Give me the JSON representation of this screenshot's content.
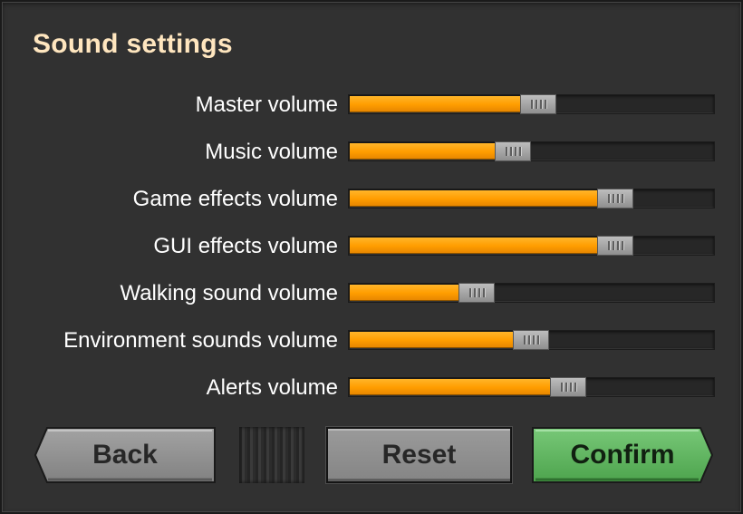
{
  "title": "Sound settings",
  "sliders": [
    {
      "label": "Master volume",
      "value": 0.47
    },
    {
      "label": "Music volume",
      "value": 0.4
    },
    {
      "label": "Game effects volume",
      "value": 0.68
    },
    {
      "label": "GUI effects volume",
      "value": 0.68
    },
    {
      "label": "Walking sound volume",
      "value": 0.3
    },
    {
      "label": "Environment sounds volume",
      "value": 0.45
    },
    {
      "label": "Alerts volume",
      "value": 0.55
    }
  ],
  "buttons": {
    "back": "Back",
    "reset": "Reset",
    "confirm": "Confirm"
  },
  "colors": {
    "title": "#ffe6bf",
    "slider_fill": "#ff9d00",
    "confirm_button": "#5fb35f",
    "back_button": "#8e8e8e"
  }
}
